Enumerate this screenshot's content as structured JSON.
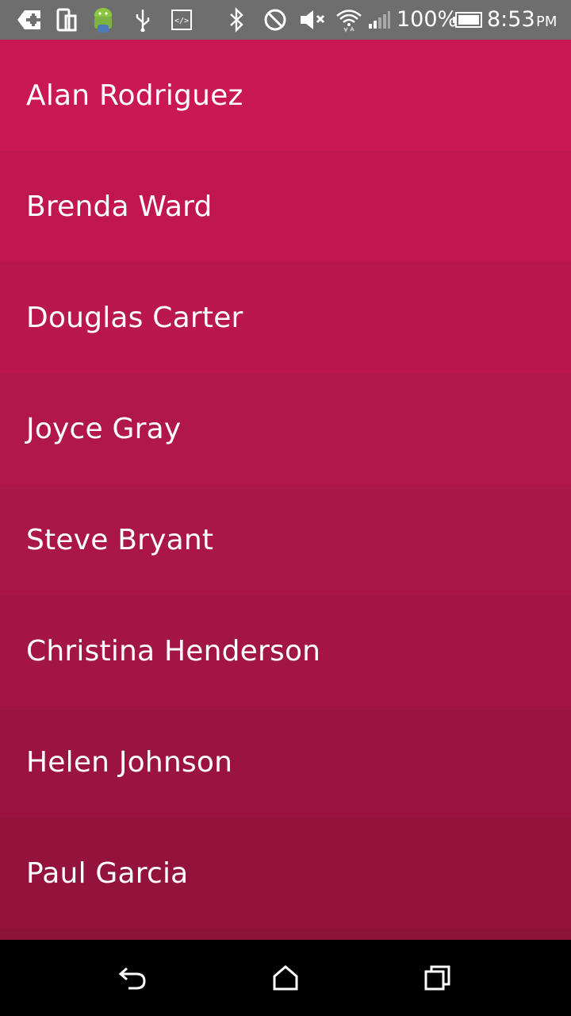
{
  "status_bar": {
    "battery": "100%",
    "time": "8:53",
    "ampm": "PM",
    "icons": [
      "notification-add-icon",
      "device-screens-icon",
      "android-debug-icon",
      "usb-icon",
      "code-icon",
      "bluetooth-icon",
      "do-not-disturb-icon",
      "volume-muted-icon",
      "wifi-icon",
      "cell-signal-icon",
      "battery-icon"
    ]
  },
  "contacts": [
    {
      "name": "Alan Rodriguez",
      "color": "#c91853"
    },
    {
      "name": "Brenda Ward",
      "color": "#c11751"
    },
    {
      "name": "Douglas Carter",
      "color": "#b9174d"
    },
    {
      "name": "Joyce Gray",
      "color": "#b2174b"
    },
    {
      "name": "Steve Bryant",
      "color": "#aa1647"
    },
    {
      "name": "Christina Henderson",
      "color": "#a21544"
    },
    {
      "name": "Helen Johnson",
      "color": "#9b1441"
    },
    {
      "name": "Paul Garcia",
      "color": "#93133d"
    },
    {
      "name": "",
      "color": "#8c123a"
    }
  ],
  "nav": {
    "icons": [
      "back-icon",
      "home-icon",
      "recents-icon"
    ]
  }
}
